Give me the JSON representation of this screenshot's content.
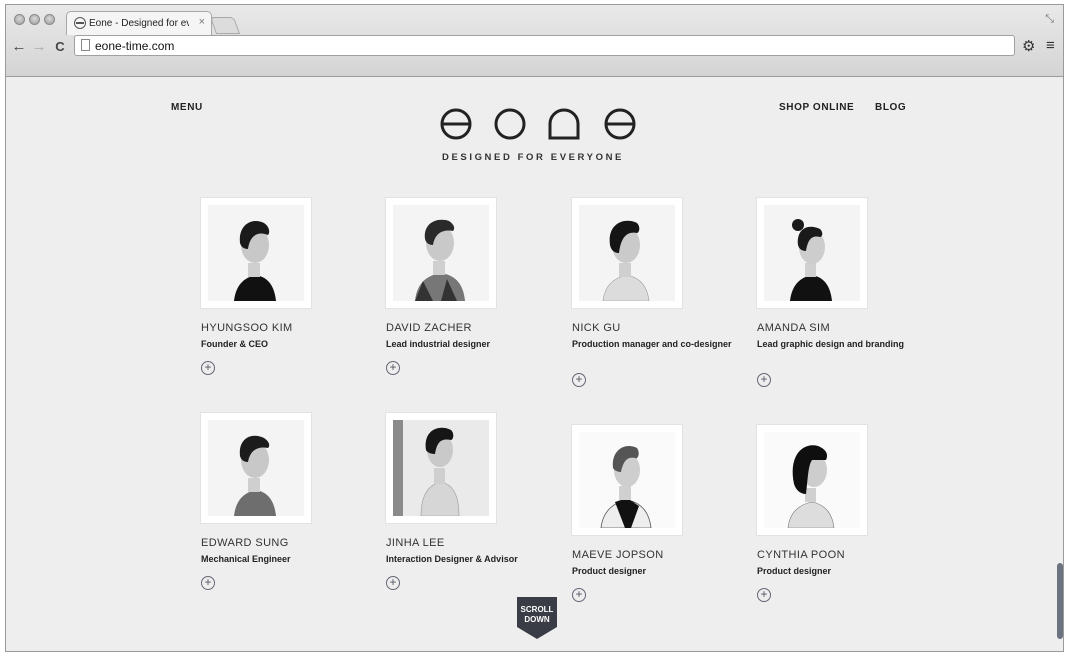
{
  "browser": {
    "tab_title": "Eone - Designed for everyone",
    "tab_close": "×",
    "url": "eone-time.com",
    "back": "←",
    "forward": "→",
    "reload": "C",
    "settings": "⚙",
    "menu": "≡",
    "restore": "⤡"
  },
  "nav": {
    "menu_label": "MENU",
    "shop_label": "SHOP ONLINE",
    "blog_label": "BLOG"
  },
  "brand": {
    "tagline": "DESIGNED FOR EVERYONE"
  },
  "team": [
    {
      "name": "HYUNGSOO KIM",
      "role": "Founder & CEO",
      "plus": "+"
    },
    {
      "name": "DAVID ZACHER",
      "role": "Lead industrial designer",
      "plus": "+"
    },
    {
      "name": "NICK GU",
      "role": "Production manager and co-designer",
      "plus": "+"
    },
    {
      "name": "AMANDA SIM",
      "role": "Lead graphic design and branding",
      "plus": "+"
    },
    {
      "name": "EDWARD SUNG",
      "role": "Mechanical Engineer",
      "plus": "+"
    },
    {
      "name": "JINHA LEE",
      "role": "Interaction Designer & Advisor",
      "plus": "+"
    },
    {
      "name": "MAEVE JOPSON",
      "role": "Product designer",
      "plus": "+"
    },
    {
      "name": "CYNTHIA POON",
      "role": "Product designer",
      "plus": "+"
    }
  ],
  "scroll": {
    "line1": "SCROLL",
    "line2": "DOWN"
  }
}
